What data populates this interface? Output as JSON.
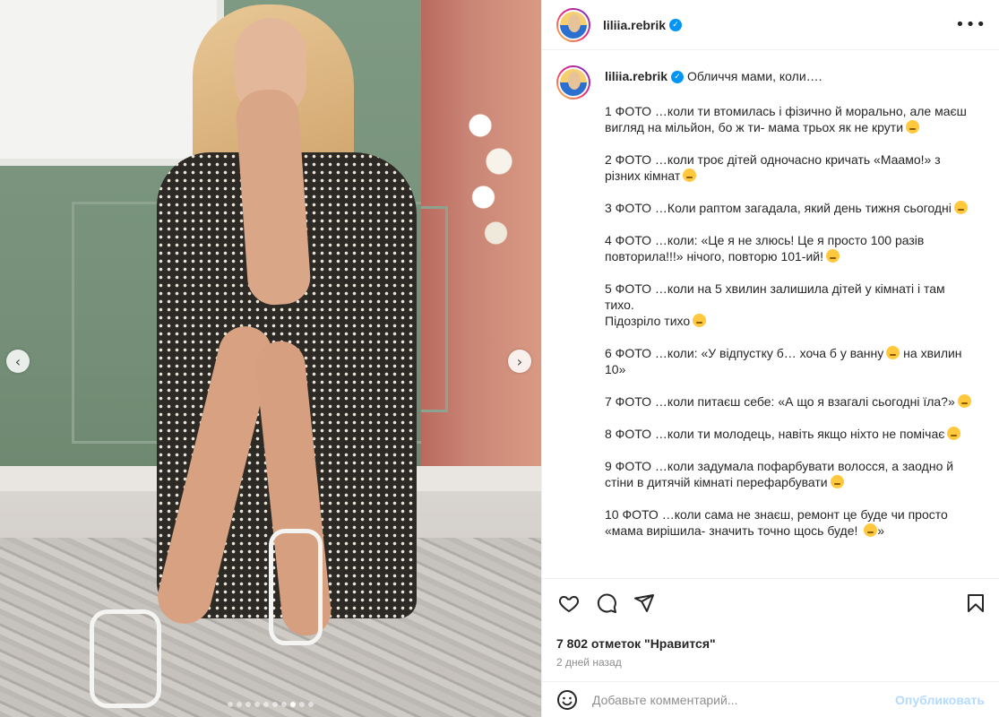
{
  "post": {
    "username": "liliia.rebrik",
    "verified_mark": "✓",
    "more_glyph": "•••",
    "caption_lead": "Обличчя мами, коли….",
    "caption_paragraphs": [
      [
        "1 ФОТО …коли ти втомилась і фізично й морально, але маєш",
        "вигляд на мільйон, бо ж ти- мама трьох як не крути"
      ],
      [
        "2 ФОТО …коли троє дітей одночасно кричать «Маамо!» з",
        "різних кімнат"
      ],
      [
        "3 ФОТО …Коли раптом загадала, який день тижня сьогодні"
      ],
      [
        "4 ФОТО …коли: «Це я не злюсь! Це я просто 100 разів",
        "повторила!!!» нічого, повторю 101-ий!"
      ],
      [
        "5 ФОТО …коли на 5 хвилин залишила дітей у кімнаті і там",
        "тихо.",
        "Підозріло тихо"
      ],
      [
        "6 ФОТО …коли: «У відпустку б… хоча б у ванну",
        "10»"
      ],
      [
        "7 ФОТО …коли питаєш себе: «А що я взагалі сьогодні їла?»"
      ],
      [
        "8 ФОТО …коли ти молодець, навіть якщо ніхто не помічає"
      ],
      [
        "9 ФОТО …коли задумала пофарбувати волосся, а заодно й",
        "стіни в дитячій кімнаті перефарбувати"
      ],
      [
        "10 ФОТО …коли сама не знаєш, ремонт це буде чи просто",
        "«мама вирішила- значить точно щось буде!"
      ]
    ],
    "para6_tail": " на хвилин",
    "para10_tail": "»",
    "likes": "7 802 отметок \"Нравится\"",
    "date": "2 дней назад"
  },
  "comment": {
    "placeholder": "Добавьте комментарий...",
    "publish_label": "Опубликовать"
  },
  "carousel": {
    "prev_glyph": "‹",
    "next_glyph": "›",
    "dot_count": 10,
    "active_dot": 7
  },
  "colors": {
    "verified": "#0095f6",
    "publish_disabled": "#b3dbff",
    "muted_text": "#8e8e8e"
  }
}
